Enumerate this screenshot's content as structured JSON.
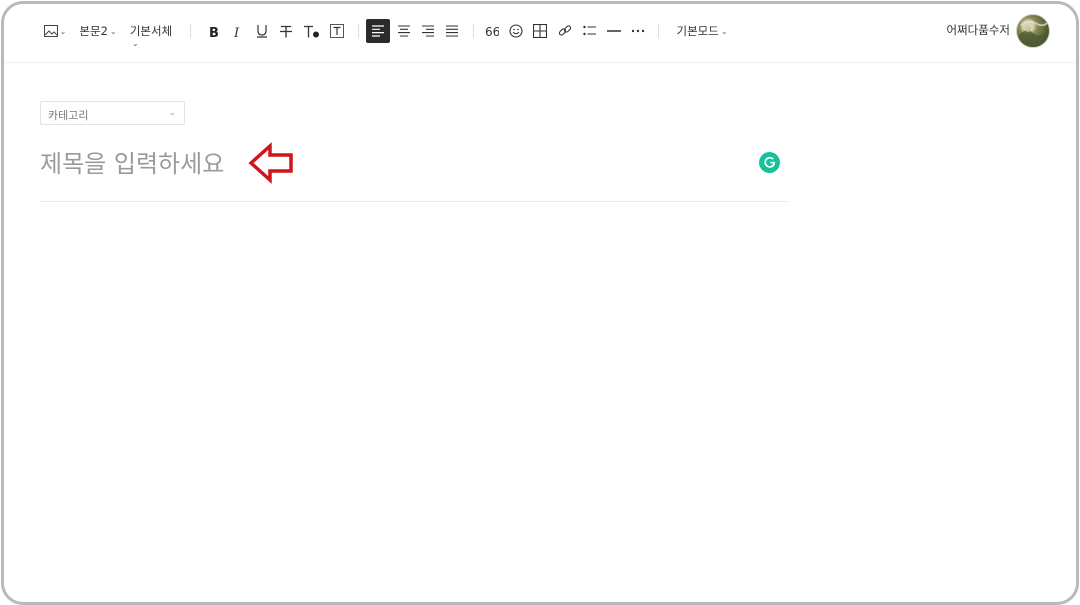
{
  "toolbar": {
    "paragraph_style": "본문2",
    "font_family": "기본서체",
    "mode": "기본모드",
    "caret": "⌄"
  },
  "user": {
    "name": "어쩌다품수저"
  },
  "editor": {
    "category_placeholder": "카테고리",
    "title_placeholder": "제목을 입력하세요"
  },
  "colors": {
    "accent_active": "#2b2b2b",
    "arrow_red": "#d0141c",
    "grammarly_green": "#15c39a"
  },
  "icons": [
    "image-icon",
    "bold-icon",
    "italic-icon",
    "underline-icon",
    "strikethrough-icon",
    "text-color-icon",
    "text-background-icon",
    "align-left-icon",
    "align-center-icon",
    "align-right-icon",
    "align-justify-icon",
    "quote-icon",
    "emoji-icon",
    "table-icon",
    "link-icon",
    "list-icon",
    "horizontal-line-icon",
    "more-icon",
    "grammarly-icon",
    "arrow-left-icon"
  ]
}
